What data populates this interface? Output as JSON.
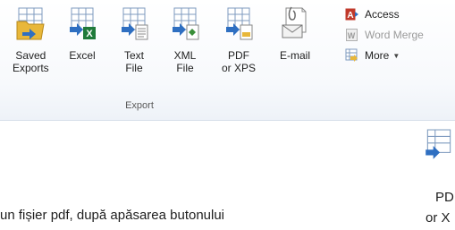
{
  "ribbon": {
    "group_label": "Export",
    "buttons": [
      {
        "label": "Saved\nExports",
        "icon": "saved-exports-icon"
      },
      {
        "label": "Excel",
        "icon": "excel-icon"
      },
      {
        "label": "Text\nFile",
        "icon": "text-file-icon"
      },
      {
        "label": "XML\nFile",
        "icon": "xml-file-icon"
      },
      {
        "label": "PDF\nor XPS",
        "icon": "pdf-xps-icon"
      },
      {
        "label": "E-mail",
        "icon": "email-icon"
      }
    ],
    "small_buttons": [
      {
        "label": "Access",
        "icon": "access-icon"
      },
      {
        "label": "Word Merge",
        "icon": "word-merge-icon"
      },
      {
        "label": "More",
        "icon": "more-icon"
      }
    ]
  },
  "body_text": "un fișier pdf, după apăsarea butonului",
  "cropped": {
    "line1": "PD",
    "line2": "or X"
  },
  "colors": {
    "ribbon_bg": "#f4f7fb",
    "excel_green": "#1f7a3a",
    "access_red": "#c0392b",
    "arrow_blue": "#2f6fc1",
    "folder_yellow": "#e8b73a"
  }
}
